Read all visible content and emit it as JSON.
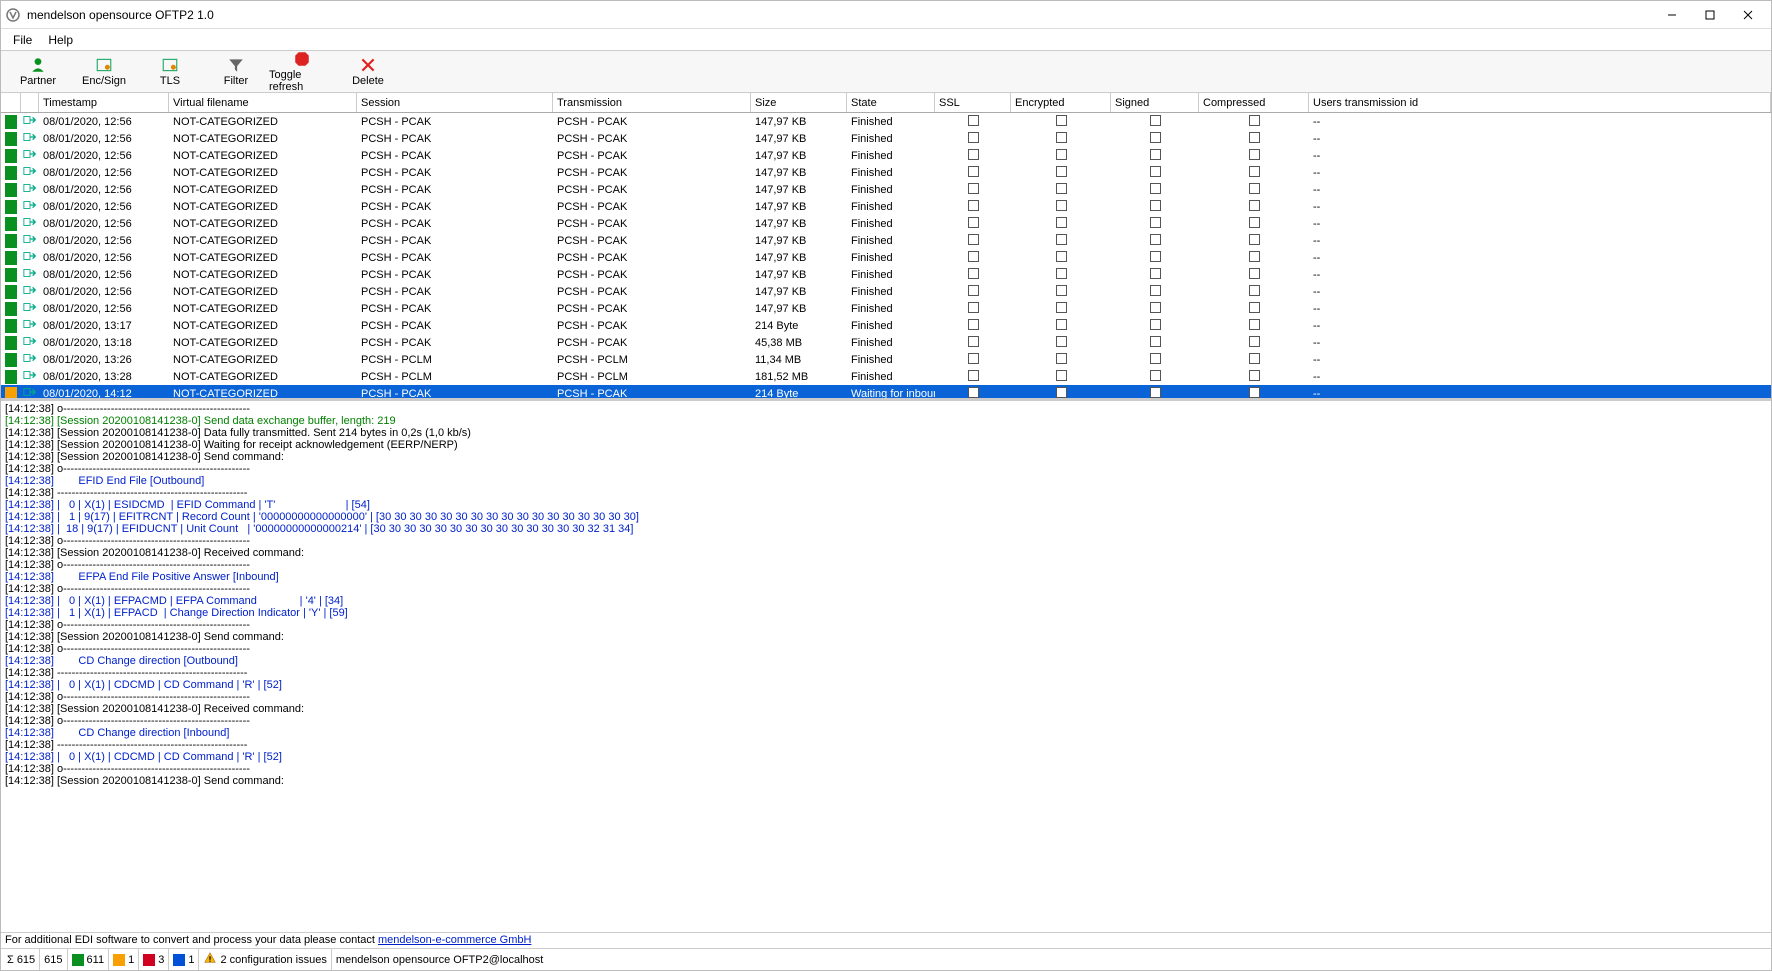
{
  "window": {
    "title": "mendelson opensource OFTP2 1.0"
  },
  "menu": {
    "file": "File",
    "help": "Help"
  },
  "toolbar": {
    "partner": {
      "label": "Partner"
    },
    "encsign": {
      "label": "Enc/Sign"
    },
    "tls": {
      "label": "TLS"
    },
    "filter": {
      "label": "Filter"
    },
    "togglerefresh": {
      "label": "Toggle refresh"
    },
    "delete": {
      "label": "Delete"
    }
  },
  "table": {
    "headers": {
      "timestamp": "Timestamp",
      "filename": "Virtual filename",
      "session": "Session",
      "transmission": "Transmission",
      "size": "Size",
      "state": "State",
      "ssl": "SSL",
      "encrypted": "Encrypted",
      "signed": "Signed",
      "compressed": "Compressed",
      "userid": "Users transmission id"
    },
    "rows": [
      {
        "status": "green",
        "direction": "out",
        "timestamp": "08/01/2020, 12:56",
        "filename": "NOT-CATEGORIZED",
        "session": "PCSH - PCAK",
        "trans": "PCSH - PCAK",
        "size": "147,97 KB",
        "state": "Finished",
        "uid": "--"
      },
      {
        "status": "green",
        "direction": "out",
        "timestamp": "08/01/2020, 12:56",
        "filename": "NOT-CATEGORIZED",
        "session": "PCSH - PCAK",
        "trans": "PCSH - PCAK",
        "size": "147,97 KB",
        "state": "Finished",
        "uid": "--"
      },
      {
        "status": "green",
        "direction": "out",
        "timestamp": "08/01/2020, 12:56",
        "filename": "NOT-CATEGORIZED",
        "session": "PCSH - PCAK",
        "trans": "PCSH - PCAK",
        "size": "147,97 KB",
        "state": "Finished",
        "uid": "--"
      },
      {
        "status": "green",
        "direction": "out",
        "timestamp": "08/01/2020, 12:56",
        "filename": "NOT-CATEGORIZED",
        "session": "PCSH - PCAK",
        "trans": "PCSH - PCAK",
        "size": "147,97 KB",
        "state": "Finished",
        "uid": "--"
      },
      {
        "status": "green",
        "direction": "out",
        "timestamp": "08/01/2020, 12:56",
        "filename": "NOT-CATEGORIZED",
        "session": "PCSH - PCAK",
        "trans": "PCSH - PCAK",
        "size": "147,97 KB",
        "state": "Finished",
        "uid": "--"
      },
      {
        "status": "green",
        "direction": "out",
        "timestamp": "08/01/2020, 12:56",
        "filename": "NOT-CATEGORIZED",
        "session": "PCSH - PCAK",
        "trans": "PCSH - PCAK",
        "size": "147,97 KB",
        "state": "Finished",
        "uid": "--"
      },
      {
        "status": "green",
        "direction": "out",
        "timestamp": "08/01/2020, 12:56",
        "filename": "NOT-CATEGORIZED",
        "session": "PCSH - PCAK",
        "trans": "PCSH - PCAK",
        "size": "147,97 KB",
        "state": "Finished",
        "uid": "--"
      },
      {
        "status": "green",
        "direction": "out",
        "timestamp": "08/01/2020, 12:56",
        "filename": "NOT-CATEGORIZED",
        "session": "PCSH - PCAK",
        "trans": "PCSH - PCAK",
        "size": "147,97 KB",
        "state": "Finished",
        "uid": "--"
      },
      {
        "status": "green",
        "direction": "out",
        "timestamp": "08/01/2020, 12:56",
        "filename": "NOT-CATEGORIZED",
        "session": "PCSH - PCAK",
        "trans": "PCSH - PCAK",
        "size": "147,97 KB",
        "state": "Finished",
        "uid": "--"
      },
      {
        "status": "green",
        "direction": "out",
        "timestamp": "08/01/2020, 12:56",
        "filename": "NOT-CATEGORIZED",
        "session": "PCSH - PCAK",
        "trans": "PCSH - PCAK",
        "size": "147,97 KB",
        "state": "Finished",
        "uid": "--"
      },
      {
        "status": "green",
        "direction": "out",
        "timestamp": "08/01/2020, 12:56",
        "filename": "NOT-CATEGORIZED",
        "session": "PCSH - PCAK",
        "trans": "PCSH - PCAK",
        "size": "147,97 KB",
        "state": "Finished",
        "uid": "--"
      },
      {
        "status": "green",
        "direction": "out",
        "timestamp": "08/01/2020, 12:56",
        "filename": "NOT-CATEGORIZED",
        "session": "PCSH - PCAK",
        "trans": "PCSH - PCAK",
        "size": "147,97 KB",
        "state": "Finished",
        "uid": "--"
      },
      {
        "status": "green",
        "direction": "out",
        "timestamp": "08/01/2020, 13:17",
        "filename": "NOT-CATEGORIZED",
        "session": "PCSH - PCAK",
        "trans": "PCSH - PCAK",
        "size": "214 Byte",
        "state": "Finished",
        "uid": "--"
      },
      {
        "status": "green",
        "direction": "out",
        "timestamp": "08/01/2020, 13:18",
        "filename": "NOT-CATEGORIZED",
        "session": "PCSH - PCAK",
        "trans": "PCSH - PCAK",
        "size": "45,38 MB",
        "state": "Finished",
        "uid": "--"
      },
      {
        "status": "green",
        "direction": "out",
        "timestamp": "08/01/2020, 13:26",
        "filename": "NOT-CATEGORIZED",
        "session": "PCSH - PCLM",
        "trans": "PCSH - PCLM",
        "size": "11,34 MB",
        "state": "Finished",
        "uid": "--"
      },
      {
        "status": "green",
        "direction": "out",
        "timestamp": "08/01/2020, 13:28",
        "filename": "NOT-CATEGORIZED",
        "session": "PCSH - PCLM",
        "trans": "PCSH - PCLM",
        "size": "181,52 MB",
        "state": "Finished",
        "uid": "--"
      },
      {
        "status": "orange",
        "direction": "out",
        "timestamp": "08/01/2020, 14:12",
        "filename": "NOT-CATEGORIZED",
        "session": "PCSH - PCAK",
        "trans": "PCSH - PCAK",
        "size": "214 Byte",
        "state": "Waiting for inboun...",
        "uid": "--",
        "selected": true
      }
    ]
  },
  "log": [
    {
      "cls": "black",
      "text": "[14:12:38] o---------------------------------------------------"
    },
    {
      "cls": "green",
      "text": "[14:12:38] [Session 20200108141238-0] Send data exchange buffer, length: 219"
    },
    {
      "cls": "black",
      "text": "[14:12:38] [Session 20200108141238-0] Data fully transmitted. Sent 214 bytes in 0,2s (1,0 kb/s)"
    },
    {
      "cls": "black",
      "text": "[14:12:38] [Session 20200108141238-0] Waiting for receipt acknowledgement (EERP/NERP)"
    },
    {
      "cls": "black",
      "text": "[14:12:38] [Session 20200108141238-0] Send command:"
    },
    {
      "cls": "black",
      "text": "[14:12:38] o---------------------------------------------------"
    },
    {
      "cls": "blue",
      "text": "[14:12:38]        EFID End File [Outbound]"
    },
    {
      "cls": "black",
      "text": "[14:12:38] ----------------------------------------------------"
    },
    {
      "cls": "blue",
      "text": "[14:12:38] |   0 | X(1) | ESIDCMD  | EFID Command | 'T'                       | [54]"
    },
    {
      "cls": "blue",
      "text": "[14:12:38] |   1 | 9(17) | EFITRCNT | Record Count | '00000000000000000' | [30 30 30 30 30 30 30 30 30 30 30 30 30 30 30 30 30]"
    },
    {
      "cls": "blue",
      "text": "[14:12:38] |  18 | 9(17) | EFIDUCNT | Unit Count   | '00000000000000214' | [30 30 30 30 30 30 30 30 30 30 30 30 30 30 32 31 34]"
    },
    {
      "cls": "black",
      "text": "[14:12:38] o---------------------------------------------------"
    },
    {
      "cls": "black",
      "text": "[14:12:38] [Session 20200108141238-0] Received command:"
    },
    {
      "cls": "black",
      "text": "[14:12:38] o---------------------------------------------------"
    },
    {
      "cls": "blue",
      "text": "[14:12:38]        EFPA End File Positive Answer [Inbound]"
    },
    {
      "cls": "black",
      "text": "[14:12:38] o---------------------------------------------------"
    },
    {
      "cls": "blue",
      "text": "[14:12:38] |   0 | X(1) | EFPACMD | EFPA Command              | '4' | [34]"
    },
    {
      "cls": "blue",
      "text": "[14:12:38] |   1 | X(1) | EFPACD  | Change Direction Indicator | 'Y' | [59]"
    },
    {
      "cls": "black",
      "text": "[14:12:38] o---------------------------------------------------"
    },
    {
      "cls": "black",
      "text": "[14:12:38] [Session 20200108141238-0] Send command:"
    },
    {
      "cls": "black",
      "text": "[14:12:38] o---------------------------------------------------"
    },
    {
      "cls": "blue",
      "text": "[14:12:38]        CD Change direction [Outbound]"
    },
    {
      "cls": "black",
      "text": "[14:12:38] ----------------------------------------------------"
    },
    {
      "cls": "blue",
      "text": "[14:12:38] |   0 | X(1) | CDCMD | CD Command | 'R' | [52]"
    },
    {
      "cls": "black",
      "text": "[14:12:38] o---------------------------------------------------"
    },
    {
      "cls": "black",
      "text": "[14:12:38] [Session 20200108141238-0] Received command:"
    },
    {
      "cls": "black",
      "text": "[14:12:38] o---------------------------------------------------"
    },
    {
      "cls": "blue",
      "text": "[14:12:38]        CD Change direction [Inbound]"
    },
    {
      "cls": "black",
      "text": "[14:12:38] ----------------------------------------------------"
    },
    {
      "cls": "blue",
      "text": "[14:12:38] |   0 | X(1) | CDCMD | CD Command | 'R' | [52]"
    },
    {
      "cls": "black",
      "text": "[14:12:38] o---------------------------------------------------"
    },
    {
      "cls": "black",
      "text": "[14:12:38] [Session 20200108141238-0] Send command:"
    }
  ],
  "footer": {
    "text": "For additional EDI software to convert and process your data please contact ",
    "link": "mendelson-e-commerce GmbH"
  },
  "status": {
    "sigma": "Σ",
    "total": "615",
    "total2": "615",
    "green": "611",
    "orange": "1",
    "red": "3",
    "blue": "1",
    "config_issues": "2 configuration issues",
    "server": "mendelson opensource OFTP2@localhost"
  }
}
